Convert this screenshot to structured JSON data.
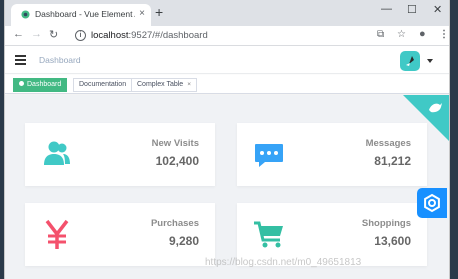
{
  "browser": {
    "tab_title": "Dashboard - Vue Element Adr",
    "tab_close": "×",
    "new_tab": "+",
    "min": "—",
    "max": "☐",
    "close": "✕",
    "url_host": "localhost",
    "url_path": ":9527/#/dashboard"
  },
  "navbar": {
    "breadcrumb": "Dashboard"
  },
  "tags": [
    {
      "label": "Dashboard",
      "active": true
    },
    {
      "label": "Documentation",
      "active": false
    },
    {
      "label": "Complex Table",
      "active": false,
      "closable": true
    }
  ],
  "tag_close": "×",
  "cards": {
    "visits": {
      "label": "New Visits",
      "value": "102,400",
      "icon": "people-icon",
      "color": "#40c9c6"
    },
    "messages": {
      "label": "Messages",
      "value": "81,212",
      "icon": "message-icon",
      "color": "#36a3f7"
    },
    "purchases": {
      "label": "Purchases",
      "value": "9,280",
      "icon": "money-icon",
      "color": "#f4516c"
    },
    "shoppings": {
      "label": "Shoppings",
      "value": "13,600",
      "icon": "shopping-icon",
      "color": "#34bfa3"
    }
  },
  "watermark": "https://blog.csdn.net/m0_49651813",
  "colors": {
    "accent": "#42b983",
    "ribbon": "#40c9c6",
    "settings": "#1890ff",
    "background": "#f0f2f5"
  }
}
